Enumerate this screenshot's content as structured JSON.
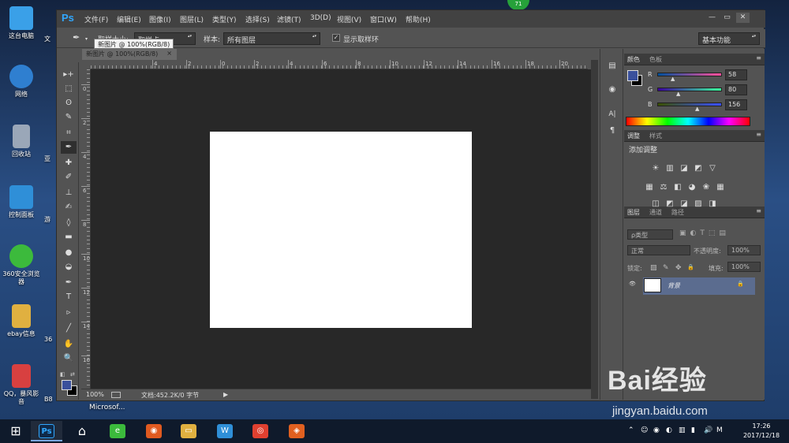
{
  "desktop": {
    "icons": [
      {
        "label": "这台电脑",
        "color": "#3aa0e8"
      },
      {
        "label": "网络",
        "color": "#2f7fd0"
      },
      {
        "label": "回收站",
        "color": "#9aa7b8"
      },
      {
        "label": "控制面板",
        "color": "#2f8fd8"
      },
      {
        "label": "360安全浏览\n器",
        "color": "#3cba3c"
      },
      {
        "label": "ebay信息",
        "color": "#e0b040"
      },
      {
        "label": "QQ，暴风影\n音",
        "color": "#d84040"
      }
    ],
    "peek_labels": [
      "文",
      "亚",
      "游",
      "36",
      "B8"
    ],
    "badge": "71",
    "taskbar_label": "Microsof..."
  },
  "ps": {
    "logo": "Ps",
    "menus": [
      "文件(F)",
      "编辑(E)",
      "图像(I)",
      "图层(L)",
      "类型(Y)",
      "选择(S)",
      "滤镜(T)",
      "3D(D)",
      "视图(V)",
      "窗口(W)",
      "帮助(H)"
    ],
    "window_buttons": [
      "—",
      "▭",
      "✕"
    ],
    "options": {
      "tool_glyph": "✒",
      "sample_size_label": "取样大小:",
      "sample_size_value": "取样点",
      "sample_label": "样本:",
      "sample_value": "所有图层",
      "show_ring_label": "显示取样环",
      "workspace": "基本功能"
    },
    "tooltip": "新图片 @ 100%(RGB/8)",
    "document": {
      "tab": "新图片 @ 100%(RGB/8)",
      "tab_close": "×",
      "ruler_h": [
        "4",
        "2",
        "0",
        "2",
        "4",
        "6",
        "8",
        "10",
        "12",
        "14",
        "16",
        "18",
        "20",
        "22"
      ],
      "ruler_v": [
        "0",
        "2",
        "4",
        "6",
        "8",
        "10",
        "12",
        "14",
        "16"
      ],
      "zoom": "100%",
      "doc_info": "文档:452.2K/0 字节",
      "status_arrow": "▶"
    },
    "tools": [
      "▸+",
      "⬚",
      "ʘ",
      "✎",
      "⌗",
      "✒",
      "✚",
      "✐",
      "⊥",
      "✍",
      "◊",
      "▬",
      "●",
      "◒",
      "✒",
      "T",
      "▹",
      "╱",
      "✋",
      "🔍"
    ],
    "strip_icons": [
      "▤",
      "◉",
      "A|",
      "¶"
    ],
    "panels": {
      "color": {
        "tabs": [
          "颜色",
          "色板"
        ],
        "menu": "≡",
        "r_label": "R",
        "g_label": "G",
        "b_label": "B",
        "r": 58,
        "g": 80,
        "b": 156,
        "fg_color": "#3a509c"
      },
      "adjust": {
        "tabs": [
          "调整",
          "样式"
        ],
        "menu": "≡",
        "title": "添加调整",
        "row1": [
          "☀",
          "▥",
          "◪",
          "◩",
          "▽"
        ],
        "row2": [
          "▦",
          "⚖",
          "◧",
          "◕",
          "❀",
          "▦"
        ],
        "row3": [
          "◫",
          "◩",
          "◪",
          "▨",
          "◨"
        ]
      },
      "layers": {
        "tabs": [
          "图层",
          "通道",
          "路径"
        ],
        "menu": "≡",
        "kind": "ρ类型",
        "filter_icons": [
          "▣",
          "◐",
          "T",
          "⬚",
          "▤"
        ],
        "blend": "正常",
        "opacity_label": "不透明度:",
        "opacity": "100%",
        "lock_label": "锁定:",
        "lock_icons": [
          "▨",
          "✎",
          "✥",
          "🔒"
        ],
        "fill_label": "填充:",
        "fill": "100%",
        "eye": "👁",
        "layer_name": "背景",
        "layer_lock": "🔒"
      }
    }
  },
  "taskbar": {
    "start": "⊞",
    "apps": [
      {
        "glyph": "Ps",
        "color": "#0f2a49",
        "running": true
      },
      {
        "glyph": "⌂",
        "color": "transparent",
        "running": false
      },
      {
        "glyph": "e",
        "color": "#3cba3c",
        "running": false
      },
      {
        "glyph": "◉",
        "color": "#e05a20",
        "running": false
      },
      {
        "glyph": "▭",
        "color": "#e0b040",
        "running": false
      },
      {
        "glyph": "W",
        "color": "#2f8fd8",
        "running": false
      },
      {
        "glyph": "◎",
        "color": "#e04030",
        "running": false
      },
      {
        "glyph": "◈",
        "color": "#e06020",
        "running": false
      }
    ],
    "tray": [
      "⌃",
      "☺",
      "◉",
      "◐",
      "▥",
      "▮",
      "🔊",
      "M"
    ],
    "time": "17:26",
    "date": "2017/12/18"
  },
  "watermark": {
    "logo": "Bai经验",
    "url": "jingyan.baidu.com"
  }
}
